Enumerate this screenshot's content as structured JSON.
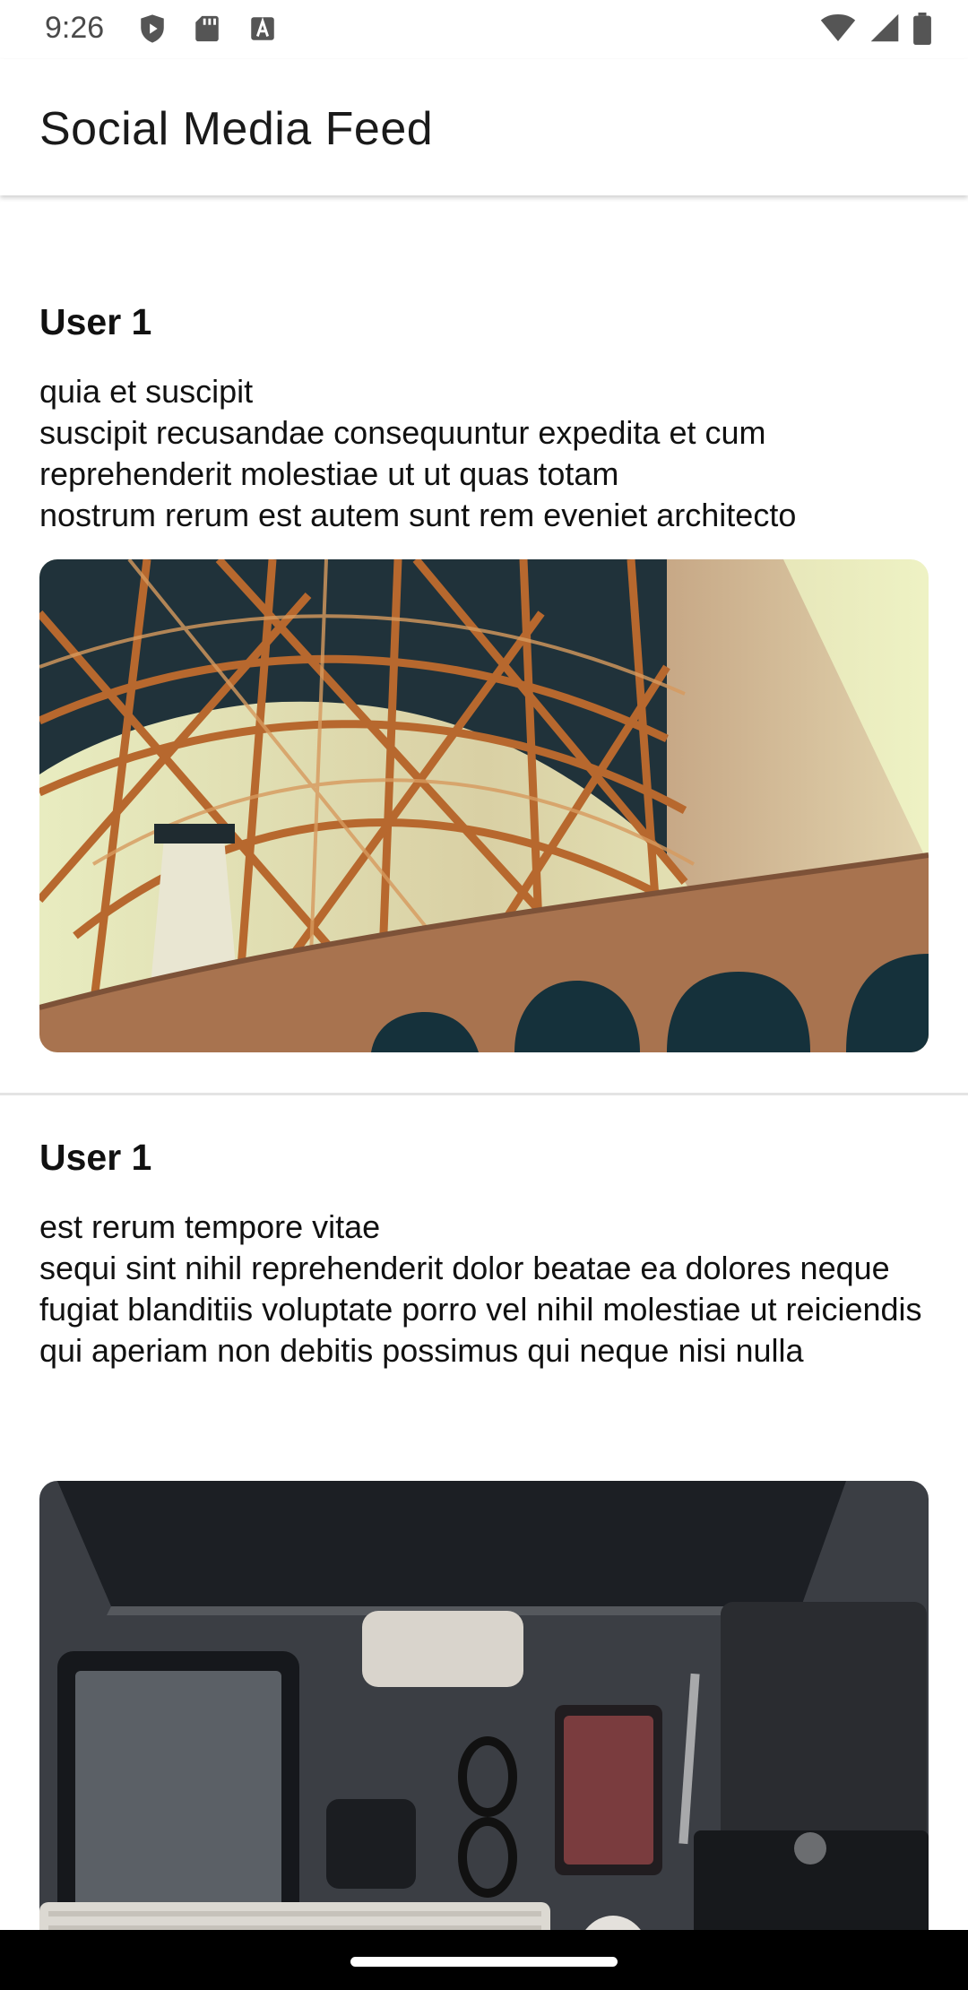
{
  "status_bar": {
    "time": "9:26",
    "left_icons": [
      "shield-play-icon",
      "sd-card-icon",
      "font-a-icon"
    ],
    "right_icons": [
      "wifi-icon",
      "signal-icon",
      "battery-icon"
    ]
  },
  "app_bar": {
    "title": "Social Media Feed"
  },
  "posts": [
    {
      "user": "User 1",
      "title": "quia et suscipit",
      "body": "suscipit recusandae consequuntur expedita et cum\nreprehenderit molestiae ut ut quas totam\nnostrum rerum est autem sunt rem eveniet architecto",
      "image": "bridge-photo"
    },
    {
      "user": "User 1",
      "title": "est rerum tempore vitae",
      "body": "sequi sint nihil reprehenderit dolor beatae ea dolores neque\nfugiat blanditiis voluptate porro vel nihil molestiae ut reiciendis\nqui aperiam non debitis possimus qui neque nisi nulla",
      "image": "desk-photo"
    }
  ],
  "colors": {
    "background": "#ffffff",
    "divider": "#e4e4e4",
    "text": "#111111",
    "nav_bar": "#000000"
  }
}
